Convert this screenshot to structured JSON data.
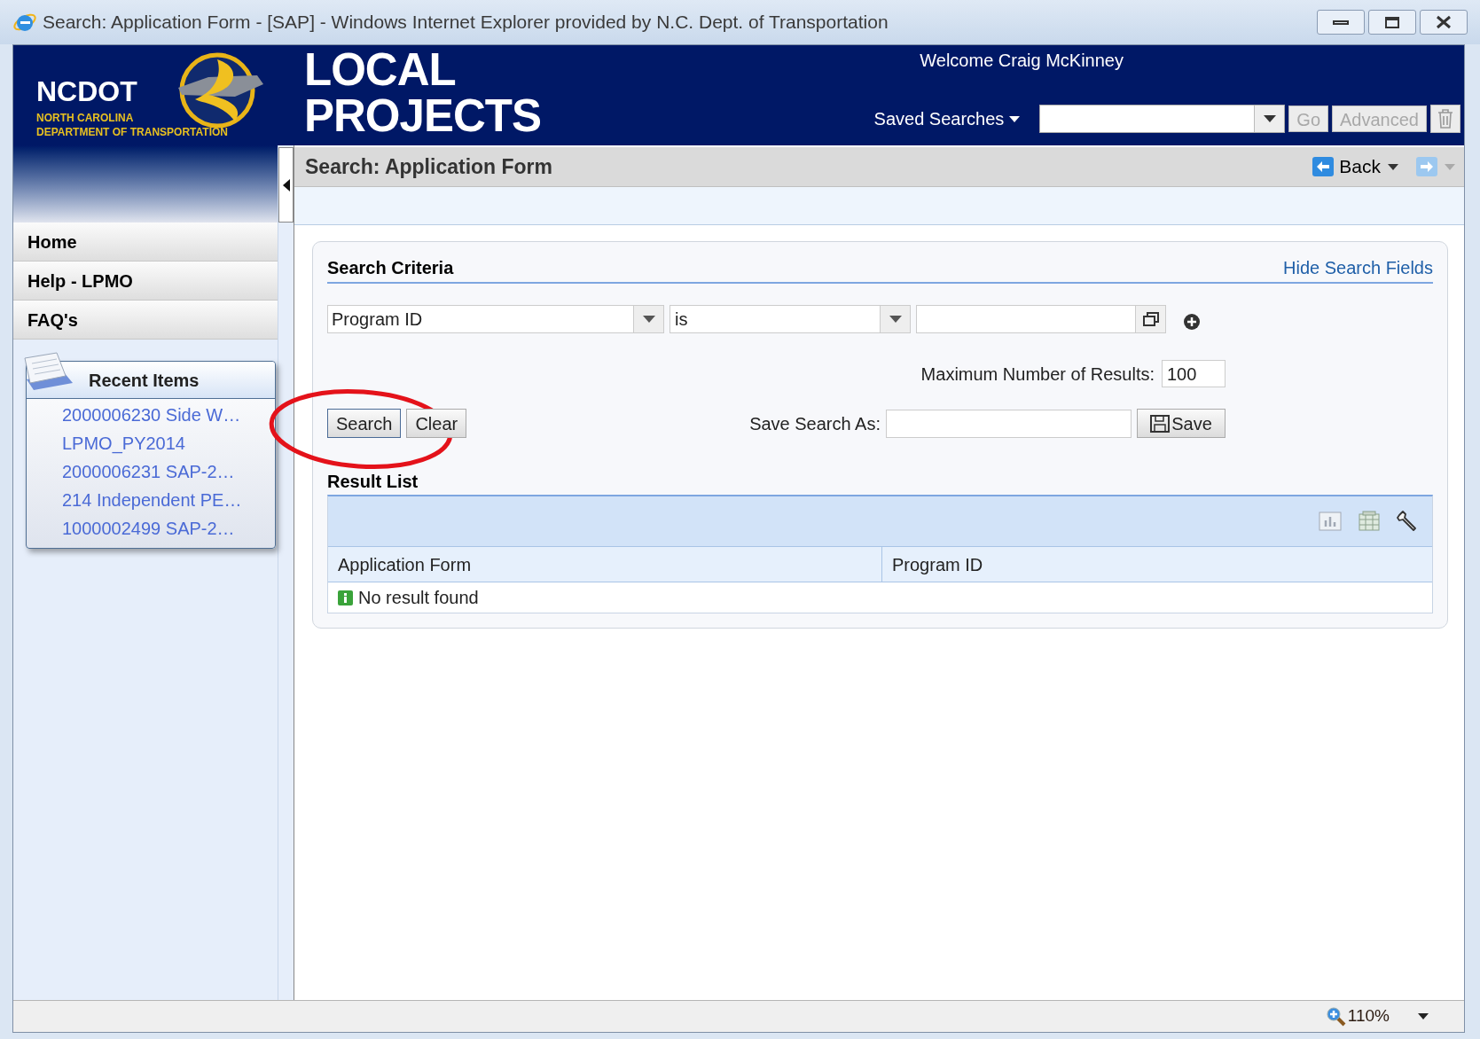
{
  "window": {
    "title": "Search: Application Form - [SAP] - Windows Internet Explorer provided by N.C. Dept. of Transportation"
  },
  "header": {
    "logo": {
      "name": "NCDOT",
      "line1": "NORTH CAROLINA",
      "line2": "DEPARTMENT OF TRANSPORTATION"
    },
    "app_title": [
      "LOCAL",
      "PROJECTS"
    ],
    "welcome": "Welcome Craig McKinney",
    "saved_searches": {
      "label": "Saved Searches",
      "buttons": [
        {
          "label": "Go",
          "disabled": true
        },
        {
          "label": "Advanced",
          "disabled": true
        }
      ]
    }
  },
  "sidebar": {
    "nav": [
      "Home",
      "Help - LPMO",
      "FAQ's"
    ],
    "recent_items": {
      "title": "Recent Items",
      "items": [
        "2000006230 Side W…",
        "LPMO_PY2014",
        "2000006231 SAP-2…",
        "214 Independent PE…",
        "1000002499 SAP-2…"
      ]
    }
  },
  "page": {
    "title": "Search: Application Form",
    "back": "Back"
  },
  "search_criteria": {
    "title": "Search Criteria",
    "hide_link": "Hide Search Fields",
    "field": "Program ID",
    "operator": "is",
    "max_results_label": "Maximum Number of Results:",
    "max_results": "100",
    "buttons": [
      "Search",
      "Clear"
    ],
    "save_as_label": "Save Search As:",
    "save_button": "Save"
  },
  "result_list": {
    "title": "Result List",
    "columns": [
      "Application Form",
      "Program ID"
    ],
    "message": "No result found"
  },
  "status_bar": {
    "zoom": "110%"
  }
}
